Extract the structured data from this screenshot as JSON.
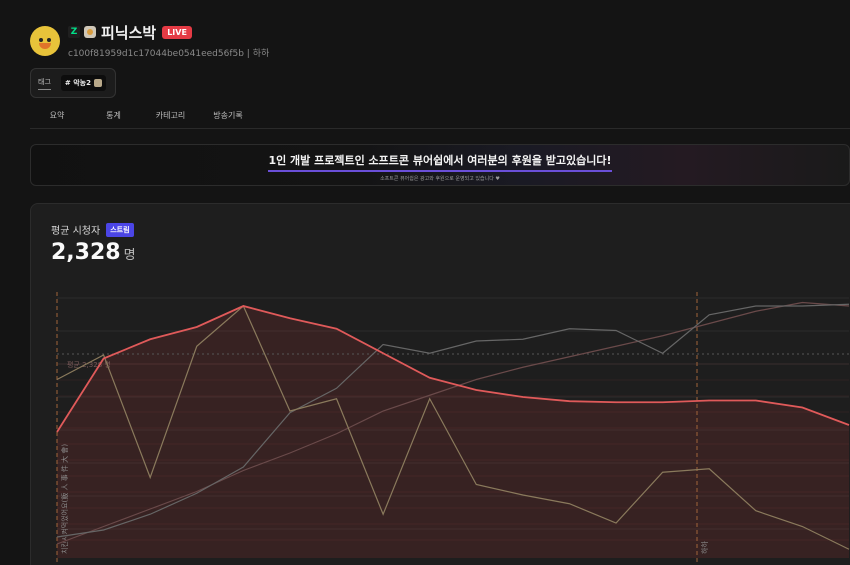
{
  "streamer": {
    "name": "피닉스박",
    "live_label": "LIVE",
    "channel_id": "c100f81959d1c17044be0541eed56f5b | 하하",
    "platform_icon": "chzzk-logo-icon",
    "platform_letter": "Z"
  },
  "tags": {
    "label": "태그",
    "chips": [
      "# 악농2"
    ]
  },
  "tabs": [
    "요약",
    "통계",
    "카테고리",
    "방송기록"
  ],
  "banner": {
    "title": "1인 개발 프로젝트인 소프트콘 뷰어쉽에서 여러분의 후원을 받고있습니다!",
    "subtitle": "소프트콘 뷰어쉽은 광고와 후원으로 운영되고 있습니다 ♥"
  },
  "metric": {
    "label": "평균 시청자",
    "badge": "스트림",
    "value": "2,328",
    "unit": "명"
  },
  "chart_data": {
    "type": "line",
    "avg_line_label": "평균 2,328 명",
    "event_label_left": "치킨시켜먹었어요(飯 人 事 件 大 會)",
    "event_label_right": "하하",
    "x_tick_labels": [
      "",
      "",
      "",
      "",
      "",
      ""
    ],
    "series": [
      {
        "color": "#e05a5a",
        "values": [
          3600,
          5700,
          6250,
          6600,
          7200,
          6850,
          6550,
          5850,
          5150,
          4800,
          4600,
          4480,
          4450,
          4450,
          4500,
          4500,
          4300,
          3800
        ]
      },
      {
        "color": "#8a7a5c",
        "values": [
          5100,
          5800,
          2300,
          6050,
          7200,
          4200,
          4550,
          1250,
          4550,
          2100,
          1800,
          1550,
          1000,
          2450,
          2550,
          1350,
          900,
          250
        ]
      },
      {
        "color": "#666666",
        "values": [
          600,
          800,
          1250,
          1850,
          2600,
          4150,
          4850,
          6100,
          5850,
          6200,
          6250,
          6550,
          6500,
          5850,
          6950,
          7200,
          7200,
          7250
        ]
      },
      {
        "color": "#6a4a4a",
        "values": [
          400,
          900,
          1400,
          1900,
          2500,
          3000,
          3550,
          4200,
          4650,
          5100,
          5450,
          5750,
          6050,
          6350,
          6700,
          7050,
          7300,
          7200
        ]
      }
    ]
  }
}
